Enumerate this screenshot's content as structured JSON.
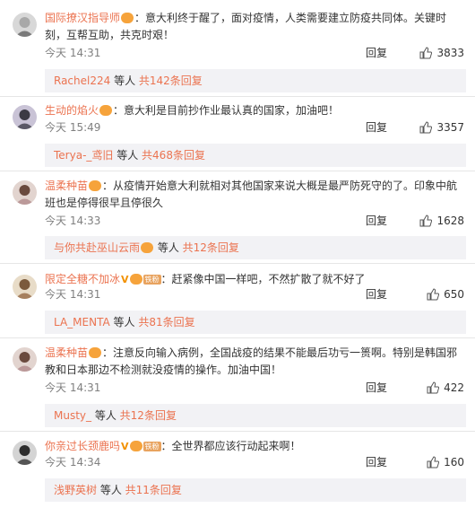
{
  "comments": [
    {
      "username": "国际撩汉指导师",
      "text": "：意大利终于醒了，面对疫情，人类需要建立防疫共同体。关键时刻，互帮互助，共克时艰！",
      "time": "今天 14:31",
      "reply_label": "回复",
      "likes": "3833",
      "sub_user": "Rachel224",
      "sub_mid": " 等人 ",
      "sub_count": "共142条回复"
    },
    {
      "username": "生动的焰火",
      "text": "：意大利是目前抄作业最认真的国家，加油吧！",
      "time": "今天 15:49",
      "reply_label": "回复",
      "likes": "3357",
      "sub_user": "Terya-_鸢旧",
      "sub_mid": " 等人 ",
      "sub_count": "共468条回复"
    },
    {
      "username": "温柔种苗",
      "text": "：从疫情开始意大利就相对其他国家来说大概是最严防死守的了。印象中航班也是停得很早且停很久",
      "time": "今天 14:33",
      "reply_label": "回复",
      "likes": "1628",
      "sub_user": "与你共赴巫山云雨",
      "sub_mid": " 等人 ",
      "sub_count": "共12条回复"
    },
    {
      "username": "限定全糖不加冰",
      "fan_badge": "铁粉",
      "text": "：赶紧像中国一样吧，不然扩散了就不好了",
      "time": "今天 14:31",
      "reply_label": "回复",
      "likes": "650",
      "sub_user": "LA_MENTA",
      "sub_mid": " 等人 ",
      "sub_count": "共81条回复"
    },
    {
      "username": "温柔种苗",
      "text": "：注意反向输入病例，全国战疫的结果不能最后功亏一篑啊。特别是韩国邪教和日本那边不检测就没疫情的操作。加油中国！",
      "time": "今天 14:31",
      "reply_label": "回复",
      "likes": "422",
      "sub_user": "Musty_",
      "sub_mid": " 等人 ",
      "sub_count": "共12条回复"
    },
    {
      "username": "你亲过长颈鹿吗",
      "fan_badge": "铁粉",
      "text": "：全世界都应该行动起来啊！",
      "time": "今天 14:34",
      "reply_label": "回复",
      "likes": "160",
      "sub_user": "浅野英树",
      "sub_mid": " 等人 ",
      "sub_count": "共11条回复"
    }
  ],
  "icons": {
    "badge": "vip-crown-icon",
    "like": "thumbs-up-icon"
  },
  "colors": {
    "link": "#eb7350",
    "meta": "#808080",
    "subbox_bg": "#f2f2f5"
  }
}
